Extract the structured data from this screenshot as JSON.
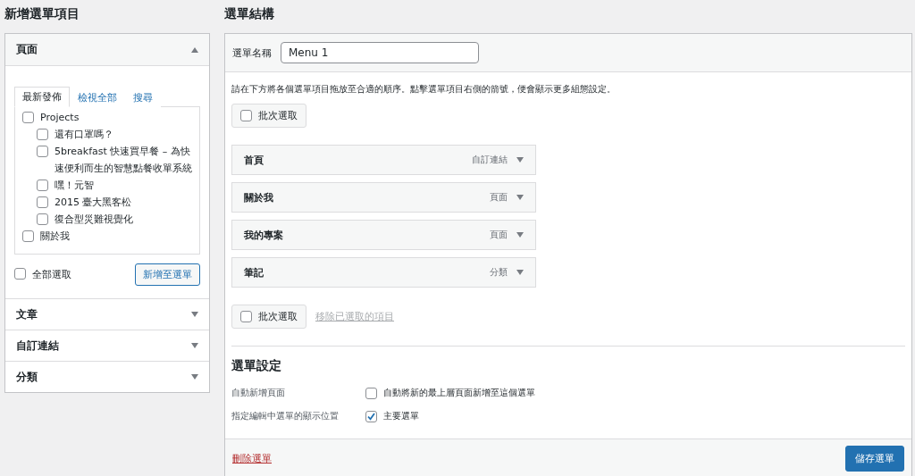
{
  "left": {
    "title": "新增選單項目",
    "sections": [
      {
        "label": "頁面",
        "expanded": true,
        "tabs": [
          {
            "label": "最新發佈",
            "selected": true
          },
          {
            "label": "檢視全部",
            "selected": false
          },
          {
            "label": "搜尋",
            "selected": false
          }
        ],
        "items": [
          {
            "label": "Projects",
            "checked": false,
            "children": [
              {
                "label": "還有口罩嗎？",
                "checked": false
              },
              {
                "label": "5breakfast 快速買早餐 – 為快速便利而生的智慧點餐收單系統",
                "checked": false
              },
              {
                "label": "嘿！元智",
                "checked": false
              },
              {
                "label": "2015 臺大黑客松",
                "checked": false
              },
              {
                "label": "復合型災難視覺化",
                "checked": false
              }
            ]
          },
          {
            "label": "關於我",
            "checked": false
          }
        ],
        "select_all": {
          "label": "全部選取",
          "checked": false
        },
        "add_button": "新增至選單"
      },
      {
        "label": "文章",
        "expanded": false
      },
      {
        "label": "自訂連結",
        "expanded": false
      },
      {
        "label": "分類",
        "expanded": false
      }
    ]
  },
  "right": {
    "title": "選單結構",
    "menu_name": {
      "label": "選單名稱",
      "value": "Menu 1"
    },
    "instructions": "請在下方將各個選單項目拖放至合適的順序。點擊選單項目右側的箭號，便會顯示更多組態設定。",
    "bulk_top": {
      "label": "批次選取",
      "checked": false
    },
    "menu_items": [
      {
        "title": "首頁",
        "type": "自訂連結"
      },
      {
        "title": "關於我",
        "type": "頁面"
      },
      {
        "title": "我的專案",
        "type": "頁面"
      },
      {
        "title": "筆記",
        "type": "分類"
      }
    ],
    "bulk_bottom": {
      "label": "批次選取",
      "checked": false
    },
    "remove_link": "移除已選取的項目",
    "settings": {
      "title": "選單設定",
      "rows": [
        {
          "label": "自動新增頁面",
          "option": "自動將新的最上層頁面新增至這個選單",
          "checked": false
        },
        {
          "label": "指定編輯中選單的顯示位置",
          "option": "主要選單",
          "checked": true
        }
      ]
    },
    "delete_link": "刪除選單",
    "save_button": "儲存選單"
  }
}
